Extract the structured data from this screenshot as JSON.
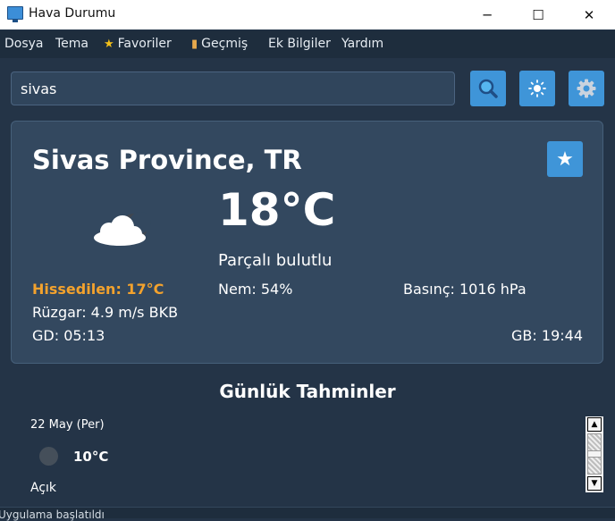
{
  "window": {
    "title": "Hava Durumu",
    "app_icon": "monitor-icon",
    "controls": {
      "minimize": "─",
      "maximize": "☐",
      "close": "✕"
    }
  },
  "menu": [
    {
      "label": "Dosya"
    },
    {
      "label": "Tema"
    },
    {
      "label": "Favoriler",
      "icon": "star-icon"
    },
    {
      "label": "Geçmiş",
      "icon": "notebook-icon"
    },
    {
      "label": "Ek Bilgiler"
    },
    {
      "label": "Yardım"
    }
  ],
  "search": {
    "value": "sivas"
  },
  "toolbar": {
    "search_icon": "search-icon",
    "theme_icon": "sun-icon",
    "settings_icon": "gear-icon"
  },
  "current": {
    "city": "Sivas Province, TR",
    "temperature": "18°C",
    "description": "Parçalı bulutlu",
    "feels_like": "Hissedilen: 17°C",
    "humidity": "Nem: 54%",
    "pressure": "Basınç: 1016 hPa",
    "wind": "Rüzgar: 4.9 m/s BKB",
    "sunrise": "GD: 05:13",
    "sunset": "GB: 19:44",
    "favorite_icon": "star-icon",
    "weather_icon": "cloudy-night-icon"
  },
  "forecast": {
    "title": "Günlük Tahminler",
    "items": [
      {
        "date": "22 May (Per)",
        "temp": "10°C",
        "desc": "Açık",
        "icon": "clear-night-icon"
      }
    ]
  },
  "statusbar": {
    "text": "Uygulama başlatıldı"
  },
  "colors": {
    "background": "#243447",
    "card": "#33485f",
    "accent": "#3f95d8",
    "feels_like": "#f3a22d",
    "favorite_star": "#f3c01a"
  }
}
